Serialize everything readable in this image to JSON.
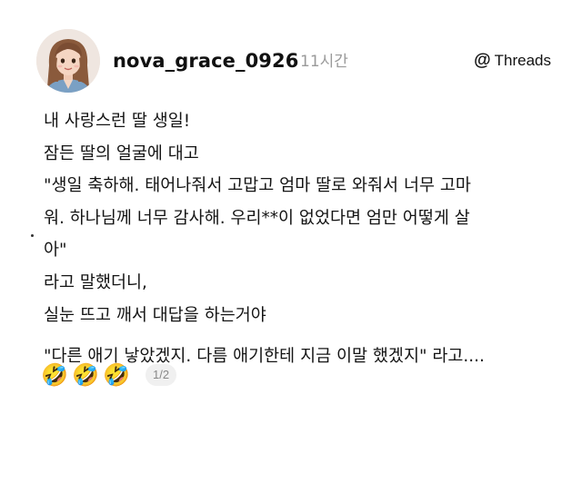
{
  "post": {
    "username": "nova_grace_0926",
    "timestamp": "11시간",
    "brand": {
      "logo_glyph": "@",
      "label": "Threads"
    },
    "body": {
      "line_1": "내 사랑스런 딸 생일!",
      "line_2": "잠든 딸의 얼굴에 대고",
      "line_3": "\"생일 축하해. 태어나줘서 고맙고 엄마 딸로 와줘서 너무 고마",
      "line_4": "워. 하나님께 너무 감사해. 우리**이 없었다면 엄만 어떻게 살",
      "line_5": "아\"",
      "line_6": "라고 말했더니,",
      "line_7": "실눈 뜨고 깨서 대답을 하는거야",
      "line_8": "\"다른 애기 낳았겠지. 다름 애기한테 지금 이말 했겠지\" 라고...."
    },
    "emojis": [
      "🤣",
      "🤣",
      "🤣"
    ],
    "page_indicator": "1/2"
  },
  "icons": {
    "avatar": "profile-avatar-illustration",
    "brand": "threads-logo-icon",
    "emoji": "rolling-on-floor-laughing-emoji"
  }
}
